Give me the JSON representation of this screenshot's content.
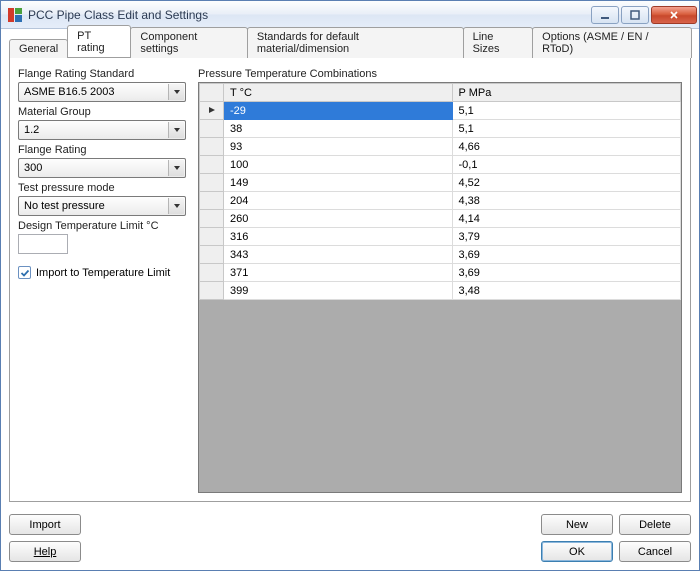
{
  "window": {
    "title": "PCC Pipe Class Edit and Settings"
  },
  "tabs": [
    {
      "label": "General"
    },
    {
      "label": "PT rating"
    },
    {
      "label": "Component settings"
    },
    {
      "label": "Standards for default material/dimension"
    },
    {
      "label": "Line Sizes"
    },
    {
      "label": "Options (ASME / EN / RToD)"
    }
  ],
  "active_tab_index": 1,
  "left": {
    "flange_standard_label": "Flange Rating Standard",
    "flange_standard_value": "ASME B16.5 2003",
    "material_group_label": "Material Group",
    "material_group_value": "1.2",
    "flange_rating_label": "Flange Rating",
    "flange_rating_value": "300",
    "test_pressure_mode_label": "Test pressure mode",
    "test_pressure_mode_value": "No test pressure",
    "design_temp_limit_label": "Design Temperature Limit °C",
    "design_temp_limit_value": "",
    "import_to_temp_limit_label": "Import to Temperature Limit",
    "import_to_temp_limit_checked": true
  },
  "grid": {
    "title": "Pressure Temperature Combinations",
    "columns": {
      "t": "T °C",
      "p": "P MPa"
    },
    "rows": [
      {
        "t": "-29",
        "p": "5,1",
        "selected": true
      },
      {
        "t": "38",
        "p": "5,1",
        "selected": false
      },
      {
        "t": "93",
        "p": "4,66",
        "selected": false
      },
      {
        "t": "100",
        "p": "-0,1",
        "selected": false
      },
      {
        "t": "149",
        "p": "4,52",
        "selected": false
      },
      {
        "t": "204",
        "p": "4,38",
        "selected": false
      },
      {
        "t": "260",
        "p": "4,14",
        "selected": false
      },
      {
        "t": "316",
        "p": "3,79",
        "selected": false
      },
      {
        "t": "343",
        "p": "3,69",
        "selected": false
      },
      {
        "t": "371",
        "p": "3,69",
        "selected": false
      },
      {
        "t": "399",
        "p": "3,48",
        "selected": false
      }
    ]
  },
  "buttons": {
    "import": "Import",
    "new": "New",
    "delete": "Delete",
    "help": "Help",
    "ok": "OK",
    "cancel": "Cancel"
  }
}
